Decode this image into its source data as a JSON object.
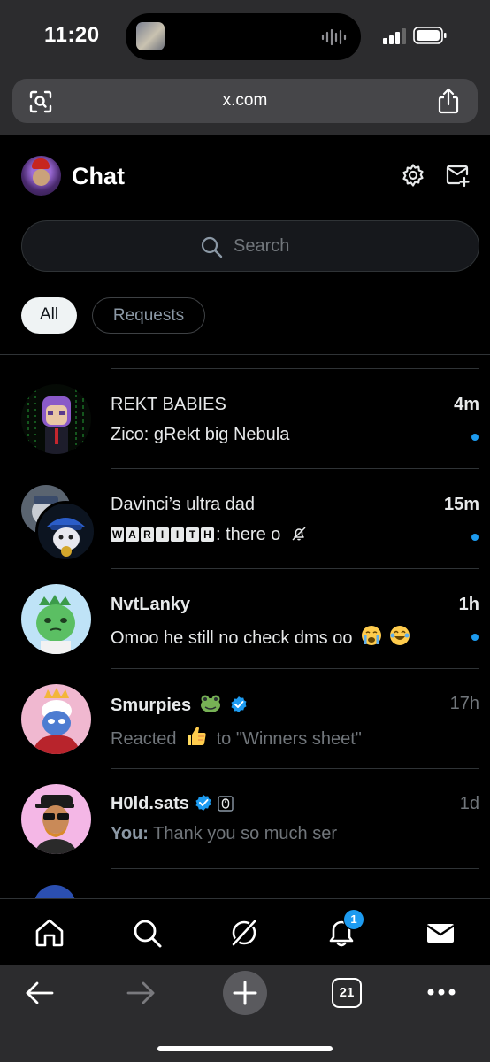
{
  "status_bar": {
    "time": "11:20"
  },
  "browser": {
    "url": "x.com",
    "tab_count": "21"
  },
  "header": {
    "title": "Chat"
  },
  "search": {
    "placeholder": "Search"
  },
  "filters": [
    {
      "label": "All",
      "selected": true
    },
    {
      "label": "Requests",
      "selected": false
    }
  ],
  "conversations": [
    {
      "name": "REKT BABIES",
      "time": "4m",
      "preview": "Zico: gRekt big Nebula",
      "unread": true
    },
    {
      "name": "Davinci’s ultra dad",
      "time": "15m",
      "sender_tag": "WARIITH",
      "preview": ": there o",
      "unread": true,
      "muted": true
    },
    {
      "name": "NvtLanky",
      "time": "1h",
      "preview": "Omoo he still no check dms oo",
      "unread": true,
      "emojis": [
        "crying-face",
        "joy-face"
      ]
    },
    {
      "name": "Smurpies",
      "name_emoji": "frog",
      "verified": true,
      "time": "17h",
      "preview_before": "Reacted",
      "preview_emoji": "thumbs-up",
      "preview_after": "to \"Winners sheet\"",
      "unread": false
    },
    {
      "name": "H0ld.sats",
      "verified": true,
      "bot_badge": true,
      "time": "1d",
      "preview_sender": "You:",
      "preview": " Thank you so much ser",
      "unread": false
    }
  ],
  "bottom_nav": {
    "notification_badge": "1"
  },
  "colors": {
    "accent": "#1d9bf0",
    "background": "#000000",
    "secondary_text": "#71767b"
  }
}
